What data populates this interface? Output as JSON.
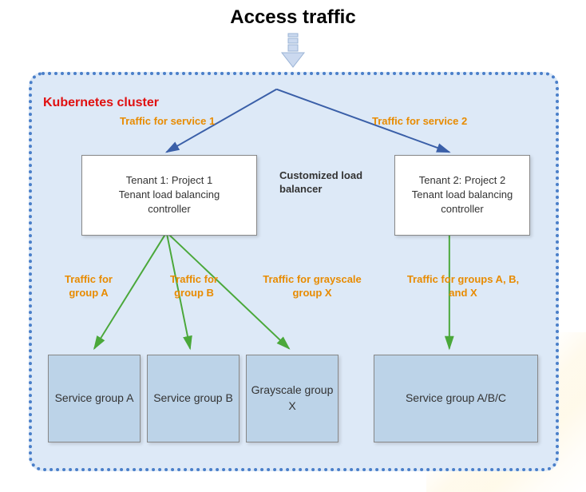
{
  "title": "Access traffic",
  "cluster_label": "Kubernetes cluster",
  "edge_labels": {
    "service1": "Traffic for service 1",
    "service2": "Traffic for service 2",
    "groupA": "Traffic for group A",
    "groupB": "Traffic for group B",
    "grayscaleX": "Traffic for grayscale group X",
    "groupsABX": "Traffic for groups A, B, and X"
  },
  "center_label": "Customized load balancer",
  "tenant1": {
    "line1": "Tenant 1: Project 1",
    "line2": "Tenant load balancing",
    "line3": "controller"
  },
  "tenant2": {
    "line1": "Tenant 2: Project 2",
    "line2": "Tenant load balancing",
    "line3": "controller"
  },
  "services": {
    "a": "Service group A",
    "b": "Service group B",
    "x": "Grayscale group X",
    "abc": "Service group A/B/C"
  },
  "diagram": {
    "type": "architecture",
    "entry": "Access traffic",
    "container": "Kubernetes cluster",
    "nodes": [
      {
        "id": "lb",
        "label": "Customized load balancer",
        "type": "router"
      },
      {
        "id": "t1",
        "label": "Tenant 1: Project 1 — Tenant load balancing controller",
        "type": "controller"
      },
      {
        "id": "t2",
        "label": "Tenant 2: Project 2 — Tenant load balancing controller",
        "type": "controller"
      },
      {
        "id": "sA",
        "label": "Service group A",
        "type": "service"
      },
      {
        "id": "sB",
        "label": "Service group B",
        "type": "service"
      },
      {
        "id": "gX",
        "label": "Grayscale group X",
        "type": "service"
      },
      {
        "id": "sABC",
        "label": "Service group A/B/C",
        "type": "service"
      }
    ],
    "edges": [
      {
        "from": "entry",
        "to": "lb",
        "label": ""
      },
      {
        "from": "lb",
        "to": "t1",
        "label": "Traffic for service 1"
      },
      {
        "from": "lb",
        "to": "t2",
        "label": "Traffic for service 2"
      },
      {
        "from": "t1",
        "to": "sA",
        "label": "Traffic for group A"
      },
      {
        "from": "t1",
        "to": "sB",
        "label": "Traffic for group B"
      },
      {
        "from": "t1",
        "to": "gX",
        "label": "Traffic for grayscale group X"
      },
      {
        "from": "t2",
        "to": "sABC",
        "label": "Traffic for groups A, B, and X"
      }
    ]
  }
}
